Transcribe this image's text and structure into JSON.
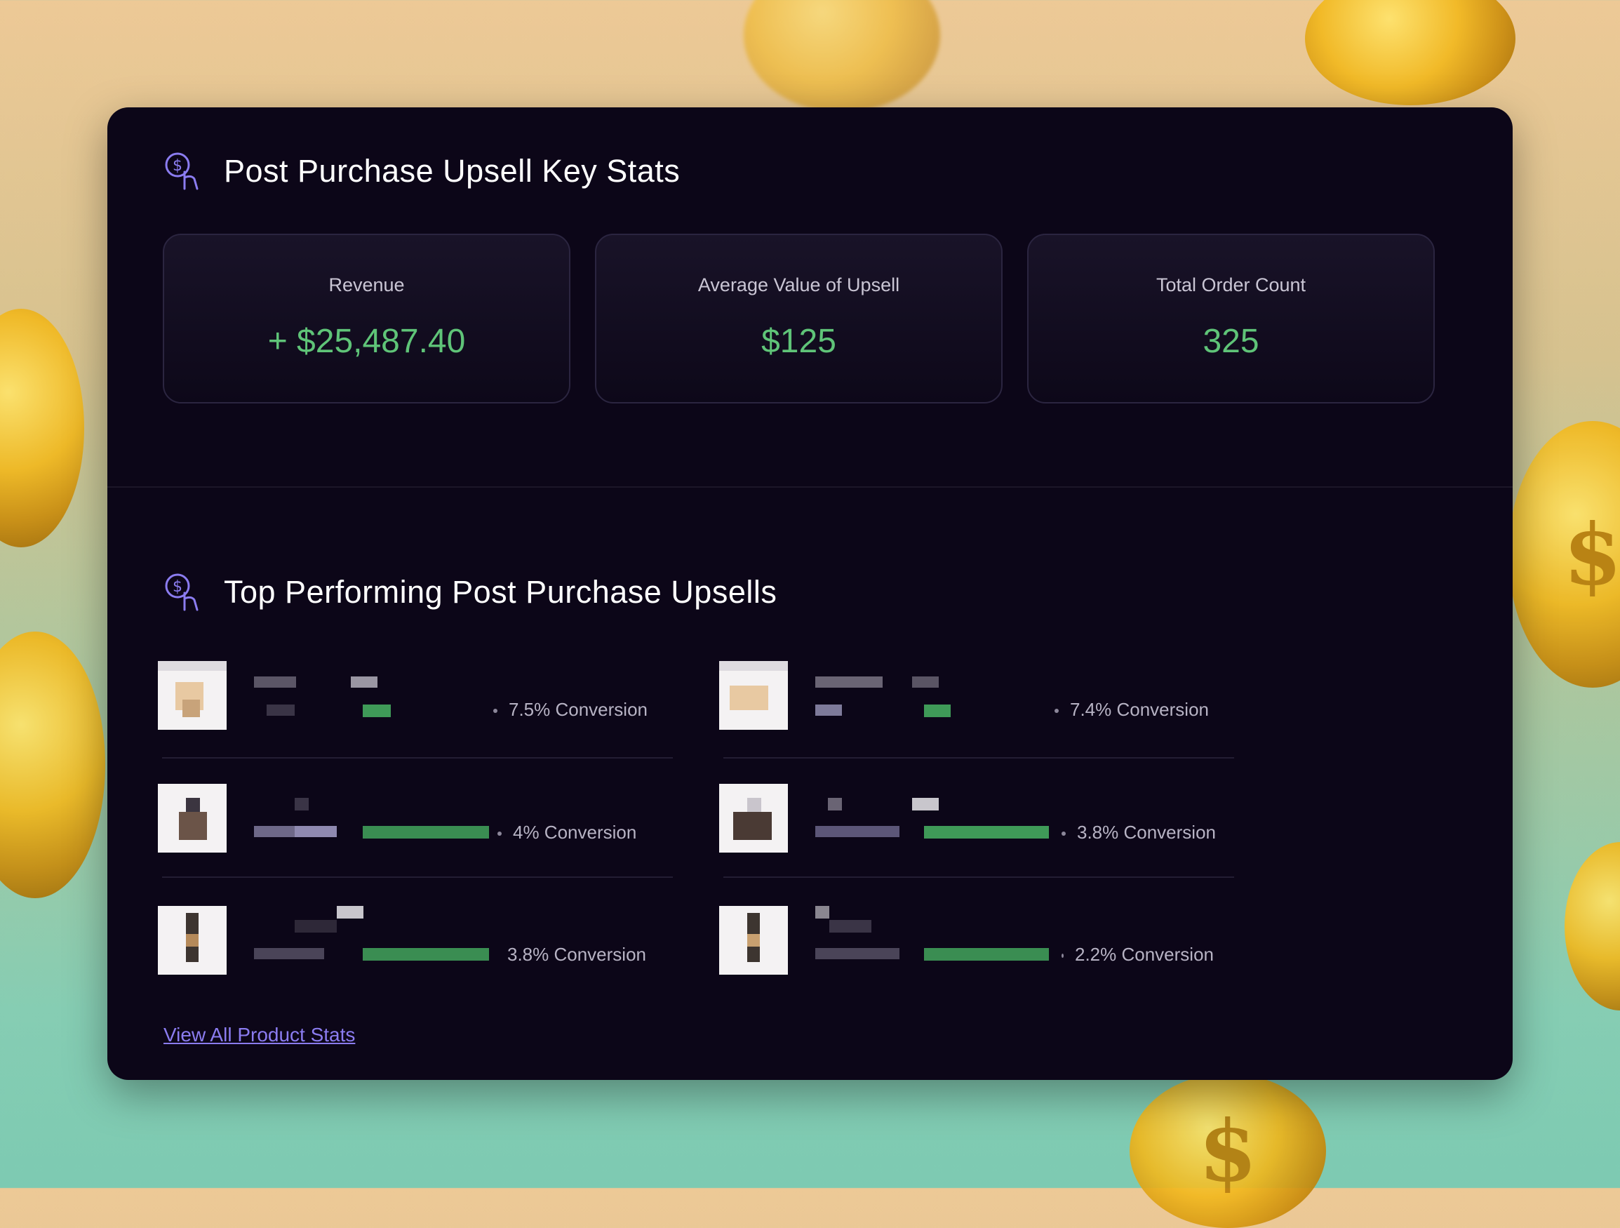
{
  "key_stats": {
    "title": "Post Purchase Upsell Key Stats",
    "cards": [
      {
        "label": "Revenue",
        "value": "+ $25,487.40"
      },
      {
        "label": "Average Value of Upsell",
        "value": "$125"
      },
      {
        "label": "Total Order Count",
        "value": "325"
      }
    ]
  },
  "top_upsells": {
    "title": "Top Performing Post Purchase Upsells",
    "items": [
      {
        "conversion": "7.5% Conversion"
      },
      {
        "conversion": "7.4% Conversion"
      },
      {
        "conversion": "4% Conversion"
      },
      {
        "conversion": "3.8% Conversion"
      },
      {
        "conversion": "3.8% Conversion"
      },
      {
        "conversion": "2.2% Conversion"
      }
    ],
    "view_all_label": "View All Product Stats"
  },
  "colors": {
    "panel_bg": "#0c0618",
    "accent": "#8b7cf0",
    "positive": "#5fc478"
  },
  "icons": {
    "section_icon": "dollar-hand-icon"
  }
}
